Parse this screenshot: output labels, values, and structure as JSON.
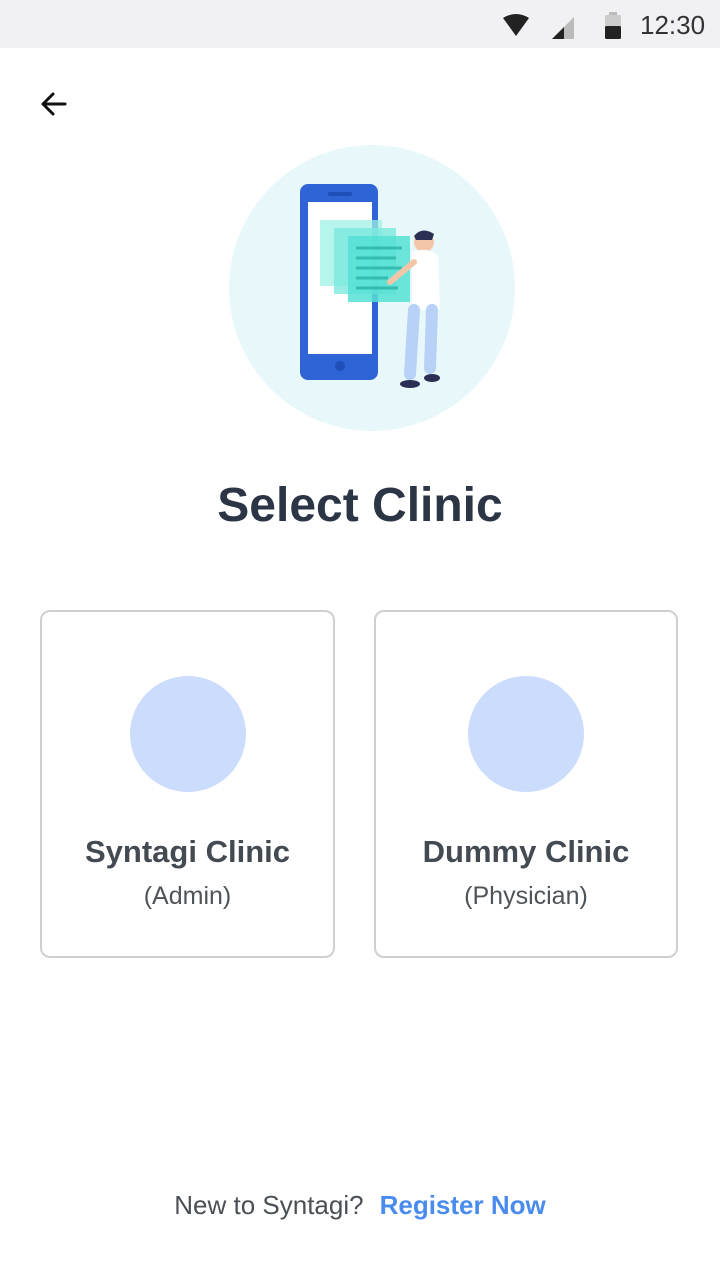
{
  "status_bar": {
    "time": "12:30",
    "icons": [
      "wifi-icon",
      "signal-icon",
      "battery-icon"
    ]
  },
  "navigation": {
    "back_icon": "arrow-left-icon"
  },
  "hero": {
    "illustration": "phone-with-person-illustration",
    "circle_color": "#e8f8fa"
  },
  "page": {
    "title": "Select Clinic"
  },
  "clinics": [
    {
      "name": "Syntagi Clinic",
      "role": "(Admin)"
    },
    {
      "name": "Dummy Clinic",
      "role": "(Physician)"
    }
  ],
  "footer": {
    "prompt": "New to Syntagi?",
    "link_label": "Register Now"
  },
  "colors": {
    "title": "#2b3545",
    "accent_link": "#4a8bee",
    "avatar_placeholder": "#ccdcfd",
    "card_border": "#cfcfd3",
    "status_bar_bg": "#f1f1f4"
  }
}
